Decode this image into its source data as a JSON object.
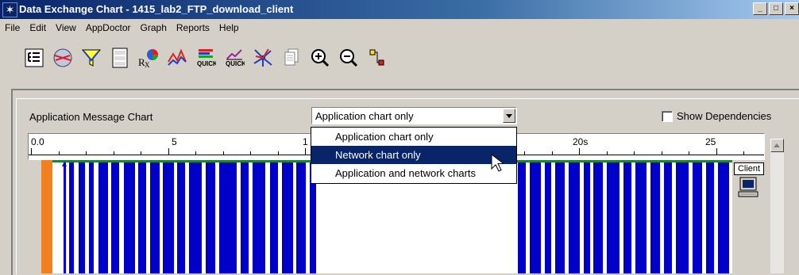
{
  "window": {
    "title": "Data Exchange Chart - 1415_lab2_FTP_download_client",
    "controls": [
      "_",
      "□",
      "×"
    ]
  },
  "menu": [
    "File",
    "Edit",
    "View",
    "AppDoctor",
    "Graph",
    "Reports",
    "Help"
  ],
  "toolbar": {
    "icons": [
      "tree-view-icon",
      "network-globe-icon",
      "filter-funnel-icon",
      "protocol-stack-icon",
      "rx-prescription-icon",
      "statistics-pie-icon",
      "graph-line-icon",
      "quick-bars-icon",
      "quick-graph-icon",
      "dependency-star-icon",
      "copy-pages-icon",
      "zoom-in-icon",
      "zoom-out-icon",
      "node-link-icon"
    ],
    "quick_label_1": "QUICK",
    "quick_label_2": "QUICK"
  },
  "panel": {
    "chart_label": "Application Message Chart",
    "chart_select": {
      "value": "Application chart only",
      "options": [
        "Application chart only",
        "Network chart only",
        "Application and network charts"
      ],
      "highlighted": "Network chart only"
    },
    "show_dependencies": {
      "label": "Show Dependencies",
      "checked": false
    }
  },
  "timeline": {
    "ticks": [
      "0.0",
      "5",
      "1",
      "20s",
      "25"
    ],
    "node_label": "Client"
  },
  "colors": {
    "message_bar": "#0000c8",
    "start_marker": "#f08020",
    "top_line": "#208040",
    "selection": "#0a246a"
  }
}
